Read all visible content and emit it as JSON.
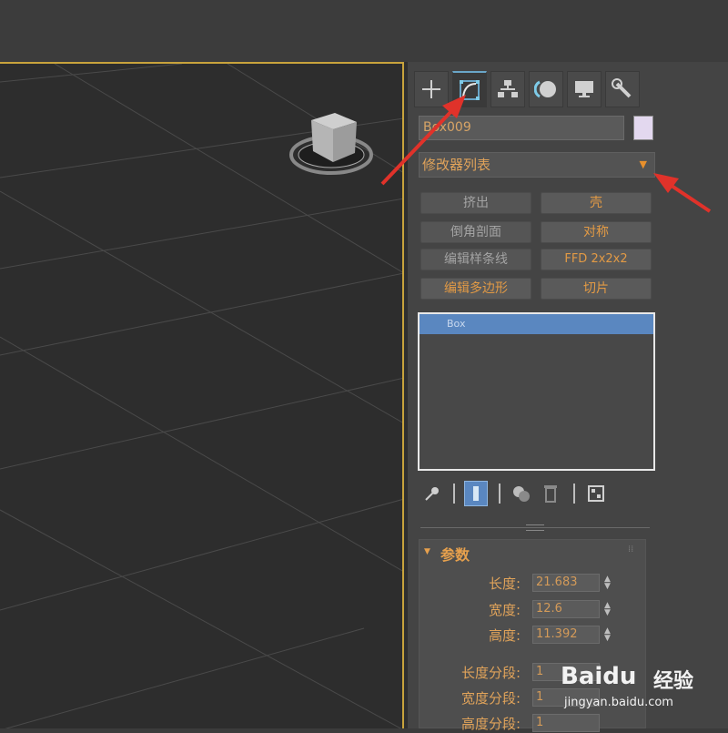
{
  "panel": {
    "object_name": "Box009",
    "object_color": "#e3d8ef",
    "modifier_list_label": "修改器列表",
    "modifier_buttons": [
      {
        "label": "挤出",
        "state": "disabled"
      },
      {
        "label": "壳",
        "state": "enabled"
      },
      {
        "label": "倒角剖面",
        "state": "disabled"
      },
      {
        "label": "对称",
        "state": "enabled"
      },
      {
        "label": "编辑样条线",
        "state": "disabled"
      },
      {
        "label": "FFD 2x2x2",
        "state": "enabled"
      },
      {
        "label": "编辑多边形",
        "state": "enabled"
      },
      {
        "label": "切片",
        "state": "enabled"
      }
    ],
    "stack": [
      {
        "label": "Box",
        "selected": true
      }
    ],
    "tabs": [
      {
        "icon": "create-plus-icon",
        "active": false
      },
      {
        "icon": "modify-icon",
        "active": true
      },
      {
        "icon": "hierarchy-icon",
        "active": false
      },
      {
        "icon": "motion-icon",
        "active": false
      },
      {
        "icon": "display-icon",
        "active": false
      },
      {
        "icon": "utilities-wrench-icon",
        "active": false
      }
    ]
  },
  "parameters": {
    "title": "参数",
    "length_label": "长度:",
    "length": "21.683",
    "width_label": "宽度:",
    "width": "12.6",
    "height_label": "高度:",
    "height": "11.392",
    "length_segs_label": "长度分段:",
    "length_segs": "1",
    "width_segs_label": "宽度分段:",
    "width_segs": "1",
    "height_segs_label": "高度分段:",
    "height_segs": "1"
  },
  "watermark": {
    "brand": "Baidu",
    "brand_cn": "经验",
    "url": "jingyan.baidu.com"
  },
  "colors": {
    "accent_orange": "#e0a35a",
    "viewport_border": "#c8a33c",
    "annotation_arrow": "#e0322a",
    "selection_blue": "#5a87c0"
  }
}
